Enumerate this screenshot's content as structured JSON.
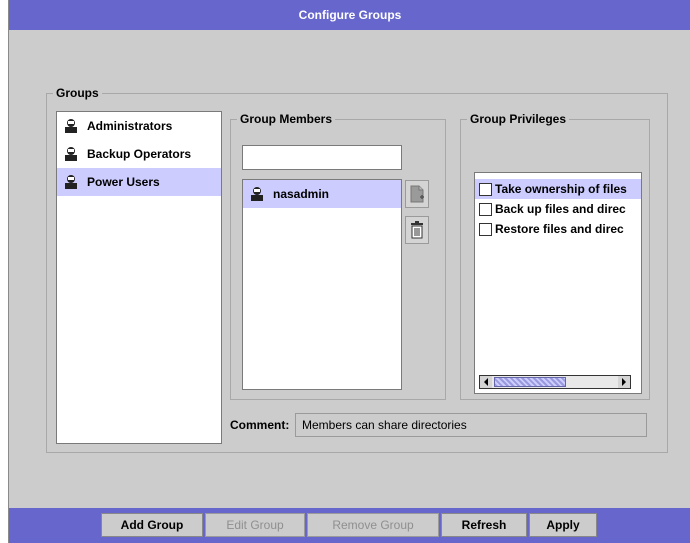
{
  "window": {
    "title": "Configure Groups"
  },
  "groups": {
    "legend": "Groups",
    "items": [
      {
        "label": "Administrators",
        "selected": false
      },
      {
        "label": "Backup Operators",
        "selected": false
      },
      {
        "label": "Power Users",
        "selected": true
      }
    ]
  },
  "members": {
    "legend": "Group Members",
    "search_value": "",
    "items": [
      {
        "label": "nasadmin",
        "selected": true
      }
    ]
  },
  "privileges": {
    "legend": "Group Privileges",
    "items": [
      {
        "label": "Take ownership of files",
        "checked": false,
        "selected": true
      },
      {
        "label": "Back up files and direc",
        "checked": false,
        "selected": false
      },
      {
        "label": "Restore files and direc",
        "checked": false,
        "selected": false
      }
    ]
  },
  "comment": {
    "label": "Comment:",
    "value": "Members can share directories"
  },
  "footer": {
    "add_group": "Add Group",
    "edit_group": "Edit Group",
    "remove_group": "Remove Group",
    "refresh": "Refresh",
    "apply": "Apply"
  },
  "colors": {
    "title_bar": "#6666cc",
    "selection": "#ccccff",
    "panel": "#cccccc"
  },
  "icons": [
    "user-group-icon",
    "user-icon",
    "add-member-icon",
    "trash-icon",
    "scroll-left-icon",
    "scroll-right-icon"
  ]
}
